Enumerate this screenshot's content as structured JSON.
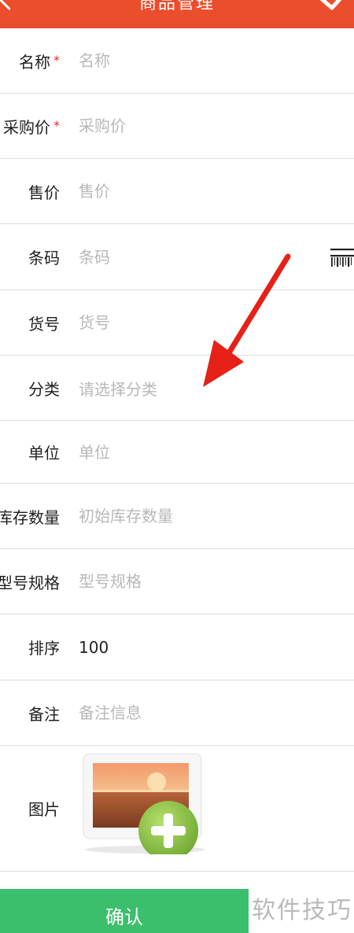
{
  "header": {
    "title": "商品管理"
  },
  "form": {
    "fields": [
      {
        "label": "名称",
        "required": true,
        "placeholder": "名称",
        "value": ""
      },
      {
        "label": "采购价",
        "required": true,
        "placeholder": "采购价",
        "value": ""
      },
      {
        "label": "售价",
        "required": false,
        "placeholder": "售价",
        "value": ""
      },
      {
        "label": "条码",
        "required": false,
        "placeholder": "条码",
        "value": ""
      },
      {
        "label": "货号",
        "required": false,
        "placeholder": "货号",
        "value": ""
      },
      {
        "label": "分类",
        "required": false,
        "hint": "请选择分类"
      },
      {
        "label": "单位",
        "required": false,
        "placeholder": "单位",
        "value": ""
      },
      {
        "label": "库存数量",
        "required": false,
        "placeholder": "初始库存数量",
        "value": ""
      },
      {
        "label": "型号规格",
        "required": false,
        "placeholder": "型号规格",
        "value": ""
      },
      {
        "label": "排序",
        "required": false,
        "placeholder": "",
        "value": "100"
      },
      {
        "label": "备注",
        "required": false,
        "placeholder": "备注信息",
        "value": ""
      },
      {
        "label": "图片",
        "required": false
      }
    ],
    "required_mark": "*"
  },
  "submit_label": "确认",
  "watermark": "软件技巧",
  "colors": {
    "header": "#ea4e2c",
    "submit": "#3bbf6d",
    "required": "#d93025",
    "annotation_arrow": "#e62117"
  }
}
